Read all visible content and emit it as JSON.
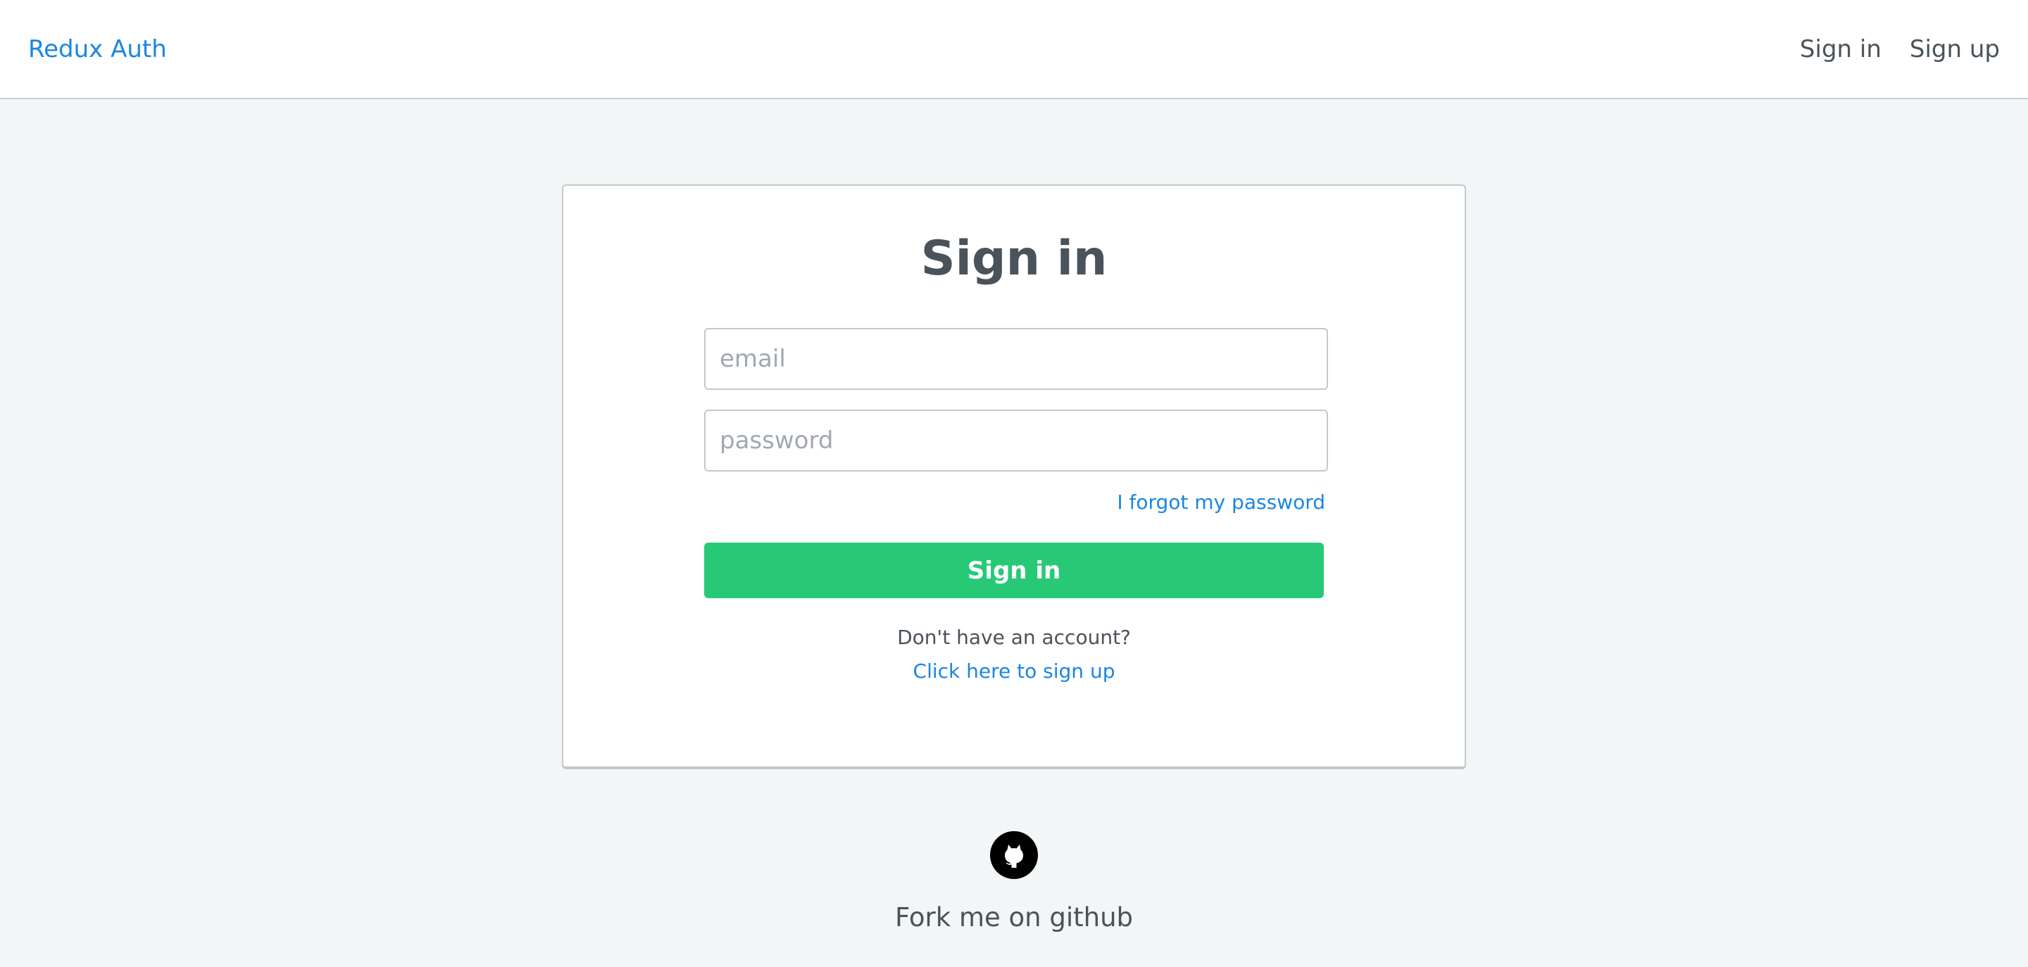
{
  "navbar": {
    "brand": "Redux Auth",
    "links": [
      "Sign in",
      "Sign up"
    ]
  },
  "form": {
    "title": "Sign in",
    "email_placeholder": "email",
    "password_placeholder": "password",
    "forgot_label": "I forgot my password",
    "submit_label": "Sign in",
    "no_account_text": "Don't have an account?",
    "signup_link_label": "Click here to sign up"
  },
  "footer": {
    "icon": "github-icon",
    "fork_text": "Fork me on github"
  },
  "colors": {
    "accent": "#1b86e0",
    "primary_button": "#28c976",
    "background": "#f3f6f6",
    "text": "#4a525a"
  }
}
